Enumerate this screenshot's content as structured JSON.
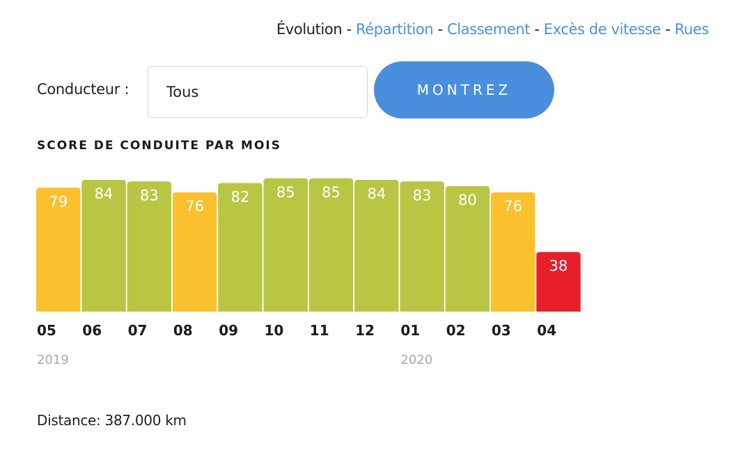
{
  "nav": {
    "current": "Évolution",
    "separator": " - ",
    "links": [
      "Répartition",
      "Classement",
      "Excès de vitesse",
      "Rues"
    ]
  },
  "form": {
    "driver_label": "Conducteur :",
    "driver_value": "Tous",
    "show_button": "MONTREZ"
  },
  "section_title": "SCORE DE CONDUITE PAR MOIS",
  "colors": {
    "good": "#b8c644",
    "average": "#fbc02d",
    "bad": "#e61f2b",
    "accent": "#4a8ede"
  },
  "chart_data": {
    "type": "bar",
    "title": "SCORE DE CONDUITE PAR MOIS",
    "xlabel": "",
    "ylabel": "",
    "ylim": [
      0,
      100
    ],
    "grid": false,
    "categories": [
      "05",
      "06",
      "07",
      "08",
      "09",
      "10",
      "11",
      "12",
      "01",
      "02",
      "03",
      "04"
    ],
    "years": [
      {
        "label": "2019",
        "at": "05"
      },
      {
        "label": "2020",
        "at": "01"
      }
    ],
    "values": [
      79,
      84,
      83,
      76,
      82,
      85,
      85,
      84,
      83,
      80,
      76,
      38
    ],
    "status": [
      "average",
      "good",
      "good",
      "average",
      "good",
      "good",
      "good",
      "good",
      "good",
      "good",
      "average",
      "bad"
    ]
  },
  "distance": "Distance: 387.000 km"
}
